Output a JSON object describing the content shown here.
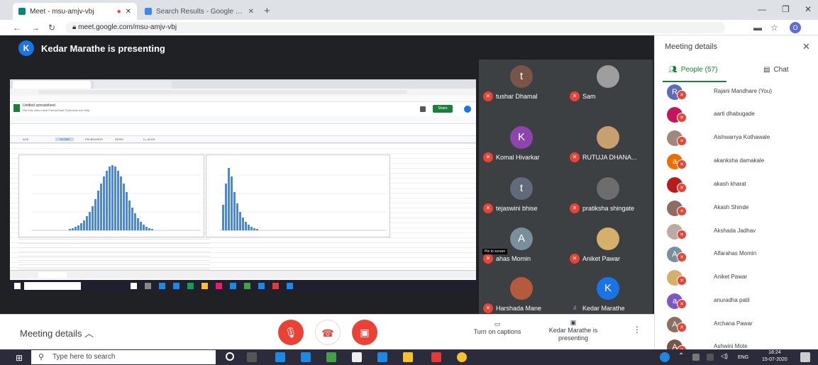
{
  "browser": {
    "tabs": [
      {
        "label": "Meet - msu-amjv-vbj"
      },
      {
        "label": "Search Results - Google Meet Fr..."
      }
    ],
    "url": "meet.google.com/msu-amjv-vbj",
    "profile_initial": "O"
  },
  "meet": {
    "presenter_initial": "K",
    "presenter_text": "Kedar Marathe is presenting",
    "pin_label": "Pin to screen",
    "participants": [
      {
        "name": "tushar Dhamal",
        "initial": "t",
        "color": "#795548"
      },
      {
        "name": "Sam",
        "initial": "",
        "color": "#9e9e9e"
      },
      {
        "name": "Komal Hivarkar",
        "initial": "K",
        "color": "#8e44ad"
      },
      {
        "name": "RUTUJA DHANA...",
        "initial": "",
        "color": "#c8a070"
      },
      {
        "name": "tejaswini bhise",
        "initial": "t",
        "color": "#5f6b7a"
      },
      {
        "name": "pratiksha shingate",
        "initial": "",
        "color": "#6d6d6d"
      },
      {
        "name": "ahas Momin",
        "initial": "A",
        "color": "#78909c"
      },
      {
        "name": "Aniket Pawar",
        "initial": "",
        "color": "#d4b06a"
      },
      {
        "name": "Harshada Mane",
        "initial": "",
        "color": "#b55a3c"
      },
      {
        "name": "Kedar Marathe",
        "initial": "K",
        "color": "#1a73e8"
      }
    ],
    "meeting_details_label": "Meeting details",
    "turn_on_captions": "Turn on captions",
    "presenting_label": "Kedar Marathe is presenting"
  },
  "panel": {
    "title": "Meeting details",
    "people_tab": "People (57)",
    "chat_tab": "Chat",
    "people": [
      {
        "name": "Rajani Mandhare (You)",
        "initial": "R",
        "color": "#5c6bc0"
      },
      {
        "name": "aarti dhabugade",
        "initial": "",
        "color": "#c2185b"
      },
      {
        "name": "Aishwarrya Kothawale",
        "initial": "",
        "color": "#a1887f"
      },
      {
        "name": "akanksha damakale",
        "initial": "a",
        "color": "#ef6c00"
      },
      {
        "name": "akash kharat",
        "initial": "",
        "color": "#b71c1c"
      },
      {
        "name": "Akash Shinde",
        "initial": "",
        "color": "#8d6e63"
      },
      {
        "name": "Akshada Jadhav",
        "initial": "",
        "color": "#bcaaa4"
      },
      {
        "name": "Alfarahas Momin",
        "initial": "A",
        "color": "#78909c"
      },
      {
        "name": "Aniket Pawar",
        "initial": "",
        "color": "#d4b06a"
      },
      {
        "name": "anuradha patil",
        "initial": "a",
        "color": "#7e57c2"
      },
      {
        "name": "Archana Pawar",
        "initial": "A",
        "color": "#8d6e63"
      },
      {
        "name": "Ashwini Mote",
        "initial": "A",
        "color": "#795548"
      }
    ]
  },
  "taskbar": {
    "search_placeholder": "Type here to search",
    "lang": "ENG",
    "time": "18:24",
    "date": "15-07-2020"
  },
  "shared_screen": {
    "doc_title": "Untitled spreadsheet",
    "menu": "File  Edit  View  Insert  Format  Data  Tools  Add-ons  Help",
    "share_label": "Share",
    "columns": [
      "AGE",
      "SCORE",
      "PRLBOUNDS",
      "RESM",
      "LL-AVGS"
    ]
  }
}
